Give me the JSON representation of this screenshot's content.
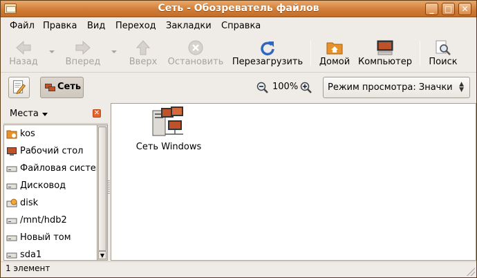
{
  "window": {
    "title": "Сеть - Обозреватель файлов"
  },
  "menubar": {
    "items": [
      "Файл",
      "Правка",
      "Вид",
      "Переход",
      "Закладки",
      "Справка"
    ]
  },
  "toolbar": {
    "back": "Назад",
    "forward": "Вперед",
    "up": "Вверх",
    "stop": "Остановить",
    "reload": "Перезагрузить",
    "home": "Домой",
    "computer": "Компьютер",
    "search": "Поиск"
  },
  "location": {
    "path_button": "Сеть",
    "zoom_level": "100%",
    "view_mode": "Режим просмотра: Значки"
  },
  "sidebar": {
    "title": "Места",
    "items": [
      {
        "label": "kos",
        "icon": "home-folder-icon"
      },
      {
        "label": "Рабочий стол",
        "icon": "desktop-icon"
      },
      {
        "label": "Файловая система",
        "icon": "drive-icon"
      },
      {
        "label": "Дисковод",
        "icon": "drive-icon"
      },
      {
        "label": "disk",
        "icon": "usb-drive-icon"
      },
      {
        "label": "/mnt/hdb2",
        "icon": "drive-icon"
      },
      {
        "label": "Новый том",
        "icon": "drive-icon"
      },
      {
        "label": "sda1",
        "icon": "drive-icon"
      }
    ]
  },
  "content": {
    "items": [
      {
        "label": "Сеть Windows",
        "icon": "network-icon"
      }
    ]
  },
  "status": {
    "text": "1 элемент"
  },
  "colors": {
    "titlebar": "#d17d37",
    "accent": "#e8622b",
    "window_bg": "#efebe7"
  }
}
